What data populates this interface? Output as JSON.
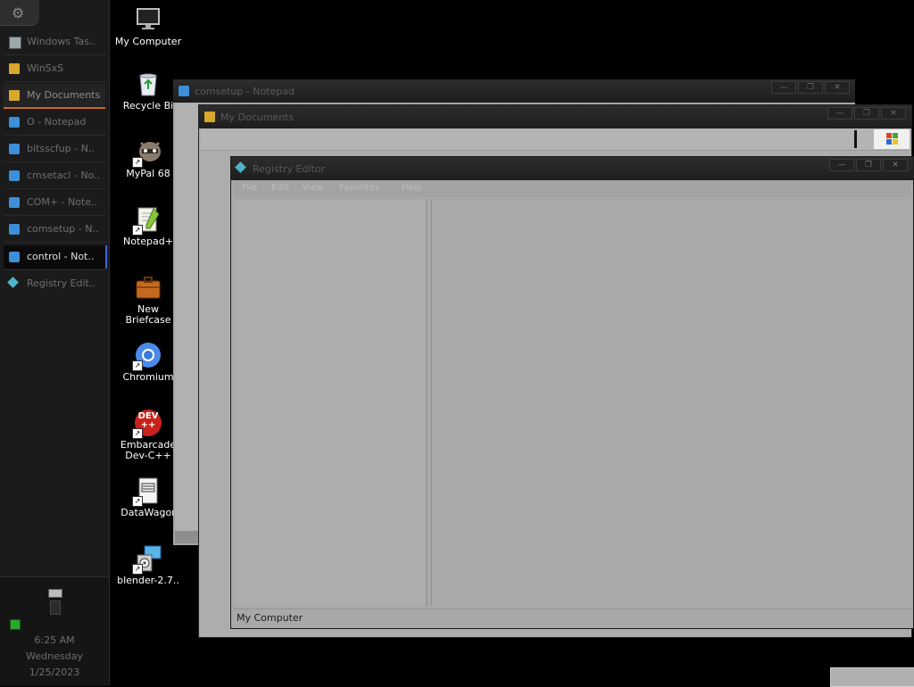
{
  "taskbar": {
    "items": [
      {
        "label": "Windows Tas..",
        "icon": "monitor-icon"
      },
      {
        "label": "WinSxS",
        "icon": "folder-icon"
      },
      {
        "label": "My Documents",
        "icon": "folder-icon"
      },
      {
        "label": "O - Notepad",
        "icon": "notepad-icon"
      },
      {
        "label": "bitsscfup - N..",
        "icon": "notepad-icon"
      },
      {
        "label": "cmsetacl - No..",
        "icon": "notepad-icon"
      },
      {
        "label": "COM+ - Note..",
        "icon": "notepad-icon"
      },
      {
        "label": "comsetup - N..",
        "icon": "notepad-icon"
      },
      {
        "label": "control - Not..",
        "icon": "notepad-icon"
      },
      {
        "label": "Registry Edit..",
        "icon": "registry-icon"
      }
    ],
    "clock": {
      "time": "6:25 AM",
      "day": "Wednesday",
      "date": "1/25/2023"
    }
  },
  "desktop": {
    "icons": [
      {
        "label": "My Computer",
        "icon": "monitor-icon"
      },
      {
        "label": "Recycle Bi",
        "icon": "recycle-bin-icon"
      },
      {
        "label": "MyPal 68",
        "icon": "mypal-raccoon-icon"
      },
      {
        "label": "Notepad+",
        "icon": "notepad-plus-icon"
      },
      {
        "label": "New\nBriefcase",
        "icon": "briefcase-icon"
      },
      {
        "label": "Chromium",
        "icon": "chromium-icon"
      },
      {
        "label": "Embarcade\nDev-C++",
        "icon": "devcpp-icon"
      },
      {
        "label": "DataWagor",
        "icon": "datawagon-icon"
      },
      {
        "label": "blender-2.7..",
        "icon": "blender-installer-icon"
      }
    ],
    "devcpp_badge": "DEV\n++"
  },
  "windows": {
    "notepad": {
      "title": "comsetup - Notepad"
    },
    "mydocs": {
      "title": "My Documents"
    },
    "regedit": {
      "title": "Registry Editor",
      "menu": [
        "File",
        "Edit",
        "View",
        "Favorites",
        "Help"
      ],
      "status": "My Computer"
    }
  },
  "window_buttons": {
    "minimize": "—",
    "maximize": "❐",
    "close": "✕"
  },
  "colors": {
    "accent_active": "#c96a1a",
    "accent_current": "#3f63d6",
    "status_led": "#2ea62e"
  }
}
